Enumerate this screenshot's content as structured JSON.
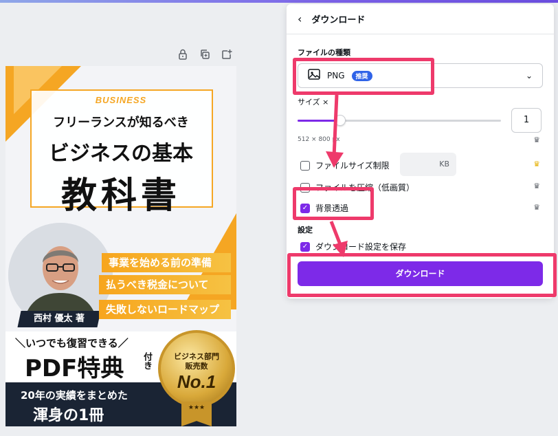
{
  "cover": {
    "eyebrow": "BUSINESS",
    "title_line1": "フリーランスが知るべき",
    "title_line2": "ビジネスの基本",
    "title_line3": "教科書",
    "author": "西村 優太 著",
    "points": [
      "事業を始める前の準備",
      "払うべき税金について",
      "失敗しないロードマップ"
    ],
    "bonus_line": "＼いつでも復習できる／",
    "bonus_big": "PDF特典",
    "bonus_small": "付き",
    "dark_line1": "20年の実績をまとめた",
    "dark_line2": "渾身の1冊",
    "medal_line1": "ビジネス部門",
    "medal_line2": "販売数",
    "medal_line3": "No.1",
    "ribbon_text": "★★★"
  },
  "panel": {
    "title": "ダウンロード",
    "file_type_label": "ファイルの種類",
    "file_type_value": "PNG",
    "file_type_badge": "推奨",
    "size_label": "サイズ ×",
    "size_value": "1",
    "size_dims": "512 × 800 px",
    "limit_label": "ファイルサイズ制限",
    "limit_unit": "KB",
    "compress_label": "ファイルを圧縮（低画質）",
    "transparent_label": "背景透過",
    "settings_label": "設定",
    "save_label": "ダウンロード設定を保存",
    "download_button": "ダウンロード"
  },
  "state": {
    "slider_level": 0.2,
    "limit_checked": false,
    "compress_checked": false,
    "transparent_checked": true,
    "save_checked": true
  },
  "colors": {
    "accent": "#7d2ae8",
    "highlight": "#ee3a6b",
    "badge": "#2f63e8",
    "cover_orange": "#f5a623",
    "cover_navy": "#1a2434"
  }
}
